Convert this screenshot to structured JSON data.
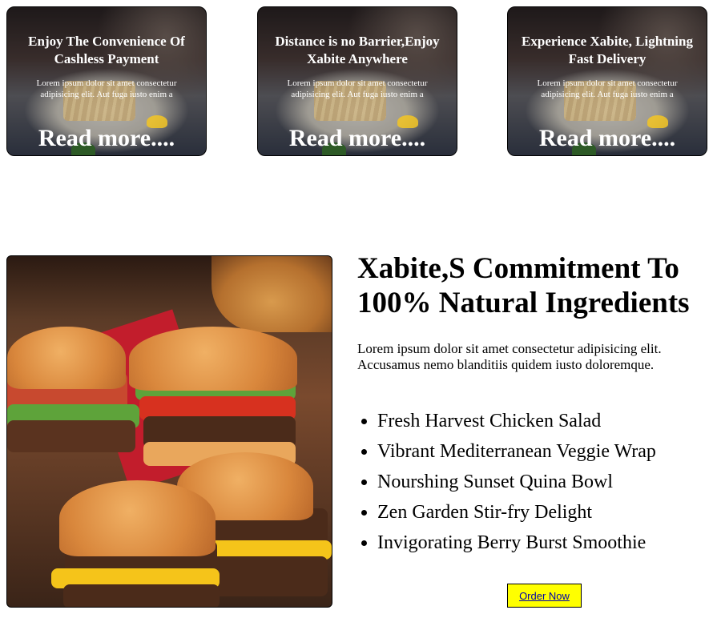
{
  "cards": [
    {
      "title": "Enjoy The Convenience Of Cashless Payment",
      "text": "Lorem ipsum dolor sit amet consectetur adipisicing elit. Aut fuga iusto enim a",
      "link": "Read more...."
    },
    {
      "title": "Distance is no Barrier,Enjoy Xabite Anywhere",
      "text": "Lorem ipsum dolor sit amet consectetur adipisicing elit. Aut fuga iusto enim a",
      "link": "Read more...."
    },
    {
      "title": "Experience Xabite, Lightning Fast Delivery",
      "text": "Lorem ipsum dolor sit amet consectetur adipisicing elit. Aut fuga iusto enim a",
      "link": "Read more...."
    }
  ],
  "commitment": {
    "headline": "Xabite,S Commitment To 100% Natural Ingredients",
    "description": "Lorem ipsum dolor sit amet consectetur adipisicing elit. Accusamus nemo blanditiis quidem iusto doloremque.",
    "items": [
      "Fresh Harvest Chicken Salad",
      "Vibrant Mediterranean Veggie Wrap",
      "Nourshing Sunset Quina Bowl",
      "Zen Garden Stir-fry Delight",
      "Invigorating Berry Burst Smoothie"
    ],
    "order_label": "Order Now"
  },
  "colors": {
    "order_button_bg": "#ffff00",
    "order_button_text": "#0000aa"
  }
}
